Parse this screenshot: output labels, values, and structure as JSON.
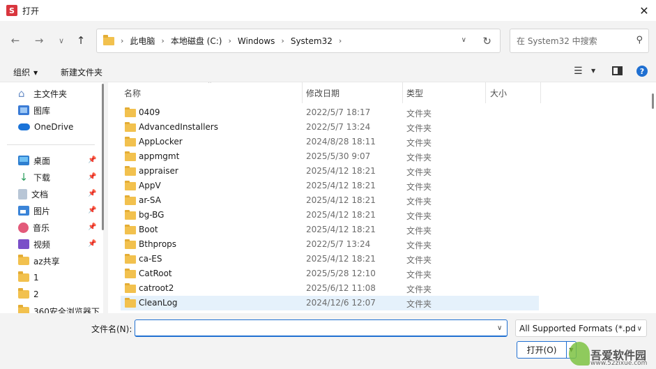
{
  "window": {
    "title": "打开",
    "app_icon_letter": "S"
  },
  "nav": {
    "breadcrumbs": [
      "此电脑",
      "本地磁盘 (C:)",
      "Windows",
      "System32"
    ],
    "search_placeholder": "在 System32 中搜索"
  },
  "toolbar": {
    "organize_label": "组织",
    "new_folder_label": "新建文件夹"
  },
  "sidebar": {
    "items": [
      {
        "label": "主文件夹",
        "icon": "home-icon"
      },
      {
        "label": "图库",
        "icon": "gallery-icon"
      },
      {
        "label": "OneDrive",
        "icon": "onedrive-icon"
      },
      {
        "label": "桌面",
        "icon": "desktop-icon",
        "pinned": true
      },
      {
        "label": "下载",
        "icon": "download-icon",
        "pinned": true
      },
      {
        "label": "文档",
        "icon": "documents-icon",
        "pinned": true
      },
      {
        "label": "图片",
        "icon": "pictures-icon",
        "pinned": true
      },
      {
        "label": "音乐",
        "icon": "music-icon",
        "pinned": true
      },
      {
        "label": "视频",
        "icon": "videos-icon",
        "pinned": true
      },
      {
        "label": "az共享",
        "icon": "folder-icon"
      },
      {
        "label": "1",
        "icon": "folder-icon"
      },
      {
        "label": "2",
        "icon": "folder-icon"
      },
      {
        "label": "360安全浏览器下",
        "icon": "folder-icon"
      }
    ]
  },
  "columns": {
    "name": "名称",
    "modified": "修改日期",
    "type": "类型",
    "size": "大小"
  },
  "files": [
    {
      "name": "0409",
      "modified": "2022/5/7 18:17",
      "type": "文件夹"
    },
    {
      "name": "AdvancedInstallers",
      "modified": "2022/5/7 13:24",
      "type": "文件夹"
    },
    {
      "name": "AppLocker",
      "modified": "2024/8/28 18:11",
      "type": "文件夹"
    },
    {
      "name": "appmgmt",
      "modified": "2025/5/30 9:07",
      "type": "文件夹"
    },
    {
      "name": "appraiser",
      "modified": "2025/4/12 18:21",
      "type": "文件夹"
    },
    {
      "name": "AppV",
      "modified": "2025/4/12 18:21",
      "type": "文件夹"
    },
    {
      "name": "ar-SA",
      "modified": "2025/4/12 18:21",
      "type": "文件夹"
    },
    {
      "name": "bg-BG",
      "modified": "2025/4/12 18:21",
      "type": "文件夹"
    },
    {
      "name": "Boot",
      "modified": "2025/4/12 18:21",
      "type": "文件夹"
    },
    {
      "name": "Bthprops",
      "modified": "2022/5/7 13:24",
      "type": "文件夹"
    },
    {
      "name": "ca-ES",
      "modified": "2025/4/12 18:21",
      "type": "文件夹"
    },
    {
      "name": "CatRoot",
      "modified": "2025/5/28 12:10",
      "type": "文件夹"
    },
    {
      "name": "catroot2",
      "modified": "2025/6/12 11:08",
      "type": "文件夹"
    },
    {
      "name": "CleanLog",
      "modified": "2024/12/6 12:07",
      "type": "文件夹",
      "selected": true
    }
  ],
  "bottom": {
    "filename_label": "文件名(N):",
    "filename_value": "",
    "filter_value": "All Supported Formats (*.pd",
    "open_label": "打开(O)"
  },
  "watermark": {
    "text": "吾爱软件园",
    "url": "www.52zixue.com"
  },
  "colors": {
    "accent": "#1f6fd1",
    "folder": "#f2c14e",
    "selected_row": "#e5f1fb",
    "app_icon": "#d9363e"
  }
}
